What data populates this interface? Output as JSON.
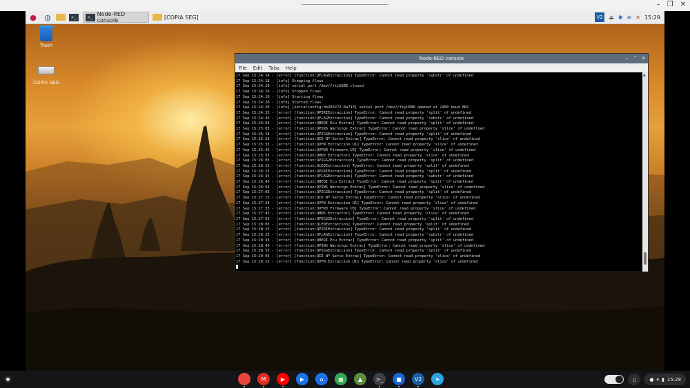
{
  "window_controls": {
    "minimize": "–",
    "restore": "❐",
    "close": "✕"
  },
  "panel": {
    "tasks": [
      {
        "label": "Node-RED console"
      },
      {
        "label": "[COPIA SEG]"
      }
    ],
    "vnc_label": "V2",
    "clock": "15:29"
  },
  "desktop_icons": [
    {
      "label": "Trash"
    },
    {
      "label": "COPIA SEG"
    }
  ],
  "terminal": {
    "title": "Node-RED console",
    "menu": [
      "File",
      "Edit",
      "Tabs",
      "Help"
    ],
    "lines": [
      "17 Sep 15:24:14 - [error] [function:QFLAGExtraccion] TypeError: Cannot read property 'substr' of undefined",
      "17 Sep 15:24:18 - [info] Stopping flows",
      "17 Sep 15:24:19 - [info] serial port /dev//ttyUSB0 closed",
      "17 Sep 15:24:19 - [info] Stopped flows",
      "17 Sep 15:24:19 - [info] Starting flows",
      "17 Sep 15:24:20 - [info] Started flows",
      "17 Sep 15:24:20 - [info] [serialconfig:db203272.0a713] serial port /dev//ttyUSB0 opened at 2400 baud 8N1",
      "17 Sep 15:24:33 - [error] [function:QPIRIExtraccion] TypeError: Cannot read property 'split' of undefined",
      "17 Sep 15:24:43 - [error] [function:QFLAGExtraccion] TypeError: Cannot read property 'substr' of undefined",
      "17 Sep 15:24:53 - [error] [function:QBEQI Ecu Extrac] TypeError: Cannot read property 'split' of undefined",
      "17 Sep 15:25:03 - [error] [function:QPIWS Warnings Extrac] TypeError: Cannot read property 'slice' of undefined",
      "17 Sep 15:25:13 - [error] [function:QPIGSExtraccion] TypeError: Cannot read property 'split' of undefined",
      "17 Sep 15:25:23 - [error] [function:QID Nº Serie Extrac] TypeError: Cannot read property 'slice' of undefined",
      "17 Sep 15:25:33 - [error] [function:QVFW Extraccion U1] TypeError: Cannot read property 'slice' of undefined",
      "17 Sep 15:25:43 - [error] [function:QVFW3 Firmware U3] TypeError: Cannot read property 'slice' of undefined",
      "17 Sep 15:25:53 - [error] [function:QMOD Extractor] TypeError: Cannot read property 'slice' of undefined",
      "17 Sep 15:26:03 - [error] [function:QPIGS2Extraccion] TypeError: Cannot read property 'split' of undefined",
      "17 Sep 15:26:13 - [error] [function:QLEDExtraccion] TypeError: Cannot read property 'split' of undefined",
      "17 Sep 15:26:23 - [error] [function:QPIRIExtraccion] TypeError: Cannot read property 'split' of undefined",
      "17 Sep 15:26:33 - [error] [function:QFLAGExtraccion] TypeError: Cannot read property 'substr' of undefined",
      "17 Sep 15:26:43 - [error] [function:QBEQI Ecu Extrac] TypeError: Cannot read property 'split' of undefined",
      "17 Sep 15:26:53 - [error] [function:QPIWS Warnings Extrac] TypeError: Cannot read property 'slice' of undefined",
      "17 Sep 15:27:03 - [error] [function:QPIGSExtraccion] TypeError: Cannot read property 'split' of undefined",
      "17 Sep 15:27:13 - [error] [function:QID Nº Serie Extrac] TypeError: Cannot read property 'slice' of undefined",
      "17 Sep 15:27:23 - [error] [function:QVFW Extraccion U1] TypeError: Cannot read property 'slice' of undefined",
      "17 Sep 15:27:33 - [error] [function:QVFW3 Firmware U3] TypeError: Cannot read property 'slice' of undefined",
      "17 Sep 15:27:43 - [error] [function:QMOD Extractor] TypeError: Cannot read property 'slice' of undefined",
      "17 Sep 15:27:53 - [error] [function:QPIGS2Extraccion] TypeError: Cannot read property 'split' of undefined",
      "17 Sep 15:28:03 - [error] [function:QLEDExtraccion] TypeError: Cannot read property 'split' of undefined",
      "17 Sep 15:28:13 - [error] [function:QPIRIExtraccion] TypeError: Cannot read property 'split' of undefined",
      "17 Sep 15:28:23 - [error] [function:QFLAGExtraccion] TypeError: Cannot read property 'substr' of undefined",
      "17 Sep 15:28:33 - [error] [function:QBEQI Ecu Extrac] TypeError: Cannot read property 'split' of undefined",
      "17 Sep 15:28:43 - [error] [function:QPIWS Warnings Extrac] TypeError: Cannot read property 'slice' of undefined",
      "17 Sep 15:28:53 - [error] [function:QPIGSExtraccion] TypeError: Cannot read property 'split' of undefined",
      "17 Sep 15:29:03 - [error] [function:QID Nº Serie Extrac] TypeError: Cannot read property 'slice' of undefined",
      "17 Sep 15:29:13 - [error] [function:QVFW Extraccion U1] TypeError: Cannot read property 'slice' of undefined"
    ]
  },
  "shelf": {
    "apps": [
      {
        "name": "chrome-icon",
        "glyph": "",
        "color": "#e8453c"
      },
      {
        "name": "gmail-icon",
        "glyph": "M",
        "color": "#d93025"
      },
      {
        "name": "youtube-icon",
        "glyph": "▶",
        "color": "#ff0000"
      },
      {
        "name": "play-store-icon",
        "glyph": "▶",
        "color": "#1a73e8"
      },
      {
        "name": "files-icon",
        "glyph": "⌂",
        "color": "#1a73e8"
      },
      {
        "name": "google-app-icon",
        "glyph": "▦",
        "color": "#34a853"
      },
      {
        "name": "linux-apps-icon",
        "glyph": "▲",
        "color": "#5b8f3c"
      },
      {
        "name": "terminal-icon",
        "glyph": ">_",
        "color": "#3c4043"
      },
      {
        "name": "files-app-icon",
        "glyph": "■",
        "color": "#1967d2"
      },
      {
        "name": "vnc-viewer-icon",
        "glyph": "V2",
        "color": "#1b5fa3"
      },
      {
        "name": "telegram-icon",
        "glyph": "➤",
        "color": "#2aa3e0"
      }
    ],
    "clock": "15:29"
  }
}
